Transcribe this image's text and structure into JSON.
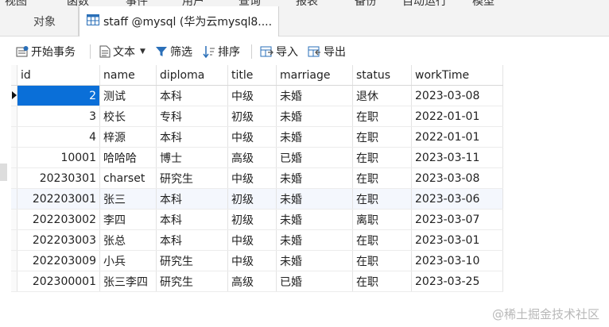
{
  "menu": [
    "视图",
    "函数",
    "事件",
    "用户",
    "查询",
    "报表",
    "备份",
    "自动运行",
    "模型"
  ],
  "tabs": {
    "objects_label": "对象",
    "active_label": "staff @mysql (华为云mysql8...."
  },
  "toolbar": {
    "begin_tx": "开始事务",
    "text": "文本",
    "filter": "筛选",
    "sort": "排序",
    "import": "导入",
    "export": "导出"
  },
  "table": {
    "columns": [
      "id",
      "name",
      "diploma",
      "title",
      "marriage",
      "status",
      "workTime"
    ],
    "rows": [
      [
        "2",
        "测试",
        "本科",
        "中级",
        "未婚",
        "退休",
        "2023-03-08"
      ],
      [
        "3",
        "校长",
        "专科",
        "初级",
        "未婚",
        "在职",
        "2022-01-01"
      ],
      [
        "4",
        "梓源",
        "本科",
        "中级",
        "未婚",
        "在职",
        "2022-01-01"
      ],
      [
        "10001",
        "哈哈哈",
        "博士",
        "高级",
        "已婚",
        "在职",
        "2023-03-11"
      ],
      [
        "20230301",
        "charset",
        "研究生",
        "中级",
        "未婚",
        "在职",
        "2023-03-08"
      ],
      [
        "202203001",
        "张三",
        "本科",
        "初级",
        "未婚",
        "在职",
        "2023-03-06"
      ],
      [
        "202203002",
        "李四",
        "本科",
        "初级",
        "未婚",
        "离职",
        "2023-03-07"
      ],
      [
        "202203003",
        "张总",
        "本科",
        "中级",
        "未婚",
        "在职",
        "2023-03-01"
      ],
      [
        "202203009",
        "小兵",
        "研究生",
        "中级",
        "未婚",
        "在职",
        "2023-03-10"
      ],
      [
        "202300001",
        "张三李四",
        "研究生",
        "高级",
        "已婚",
        "在职",
        "2023-03-25"
      ]
    ]
  },
  "watermark": "@稀土掘金技术社区",
  "colors": {
    "selection": "#0a6fd8",
    "alt_row": "#f4f7fd",
    "toolbar_icon": "#2a6fb8"
  }
}
